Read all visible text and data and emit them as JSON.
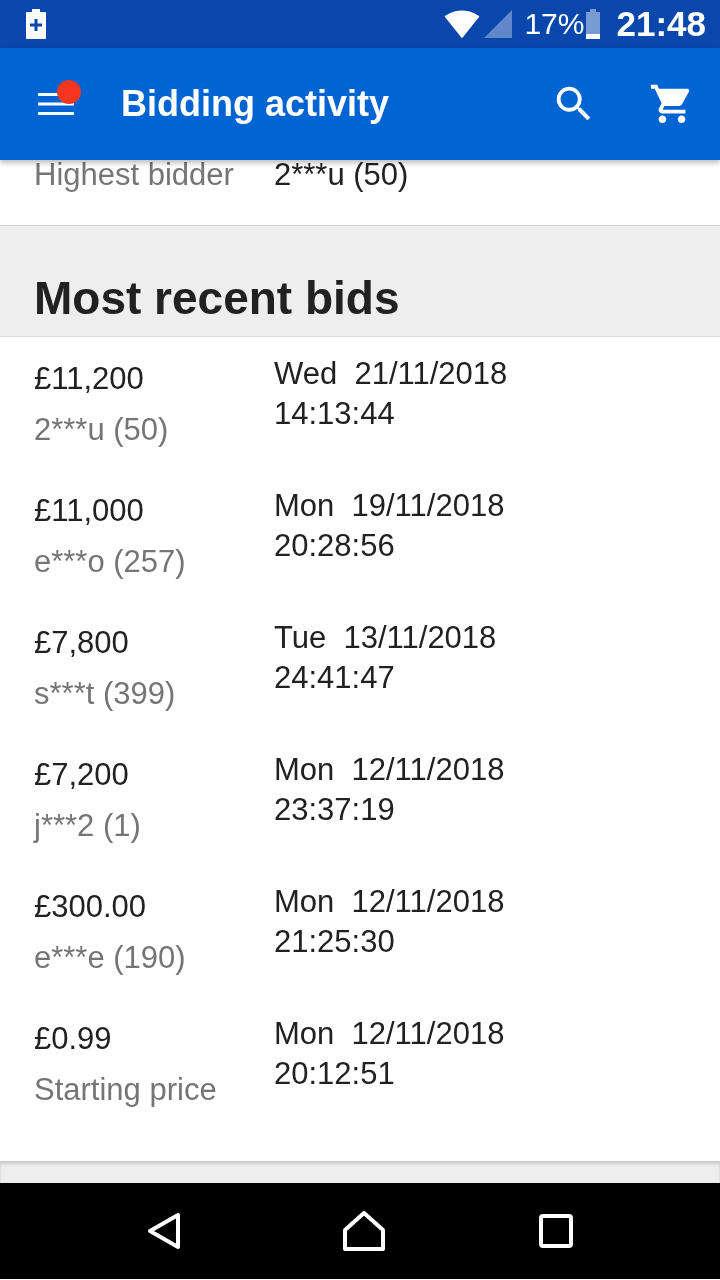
{
  "status_bar": {
    "battery_percent": "17%",
    "time": "21:48"
  },
  "app_bar": {
    "title": "Bidding activity",
    "notification_dot": true
  },
  "summary": {
    "label": "Highest bidder",
    "value": "2***u (50)"
  },
  "recent_bids": {
    "heading": "Most recent bids",
    "bids": [
      {
        "amount": "£11,200",
        "subtitle": "2***u (50)",
        "date": "Wed  21/11/2018",
        "time": "14:13:44"
      },
      {
        "amount": "£11,000",
        "subtitle": "e***o (257)",
        "date": "Mon  19/11/2018",
        "time": "20:28:56"
      },
      {
        "amount": "£7,800",
        "subtitle": "s***t (399)",
        "date": "Tue  13/11/2018",
        "time": "24:41:47"
      },
      {
        "amount": "£7,200",
        "subtitle": "j***2 (1)",
        "date": "Mon  12/11/2018",
        "time": "23:37:19"
      },
      {
        "amount": "£300.00",
        "subtitle": "e***e (190)",
        "date": "Mon  12/11/2018",
        "time": "21:25:30"
      },
      {
        "amount": "£0.99",
        "subtitle": "Starting price",
        "date": "Mon  12/11/2018",
        "time": "20:12:51"
      }
    ]
  }
}
